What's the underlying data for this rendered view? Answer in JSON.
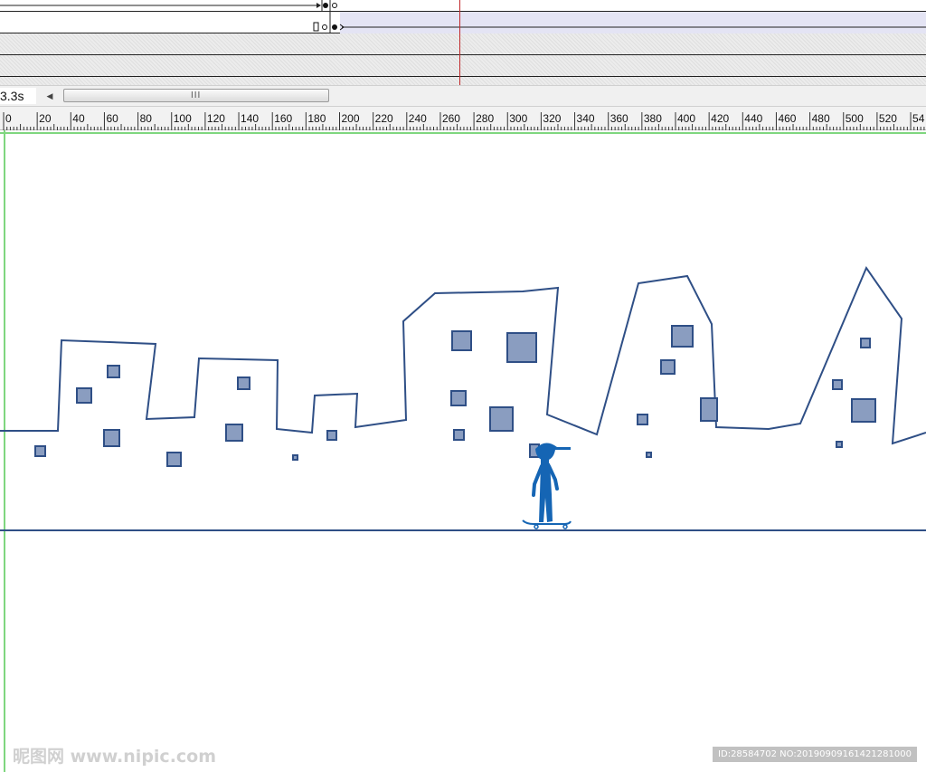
{
  "timeline": {
    "time_readout": "3.3s",
    "scroll_left_glyph": "◀",
    "scroll_grip_glyph": "III"
  },
  "ruler": {
    "ticks": [
      "0",
      "20",
      "40",
      "60",
      "80",
      "100",
      "120",
      "140",
      "160",
      "180",
      "200",
      "220",
      "240",
      "260",
      "280",
      "300",
      "320",
      "340",
      "360",
      "380",
      "400",
      "420",
      "440",
      "460",
      "480",
      "500",
      "520",
      "54"
    ]
  },
  "colors": {
    "outline": "#2f4f86",
    "window_fill": "#8a9dc0",
    "figure": "#1565b4",
    "stage_guide": "#7fd67f",
    "playhead": "#c0282a"
  },
  "watermark": {
    "left": "昵图网 www.nipic.com",
    "right": "ID:28584702 NO:20190909161421281000"
  }
}
